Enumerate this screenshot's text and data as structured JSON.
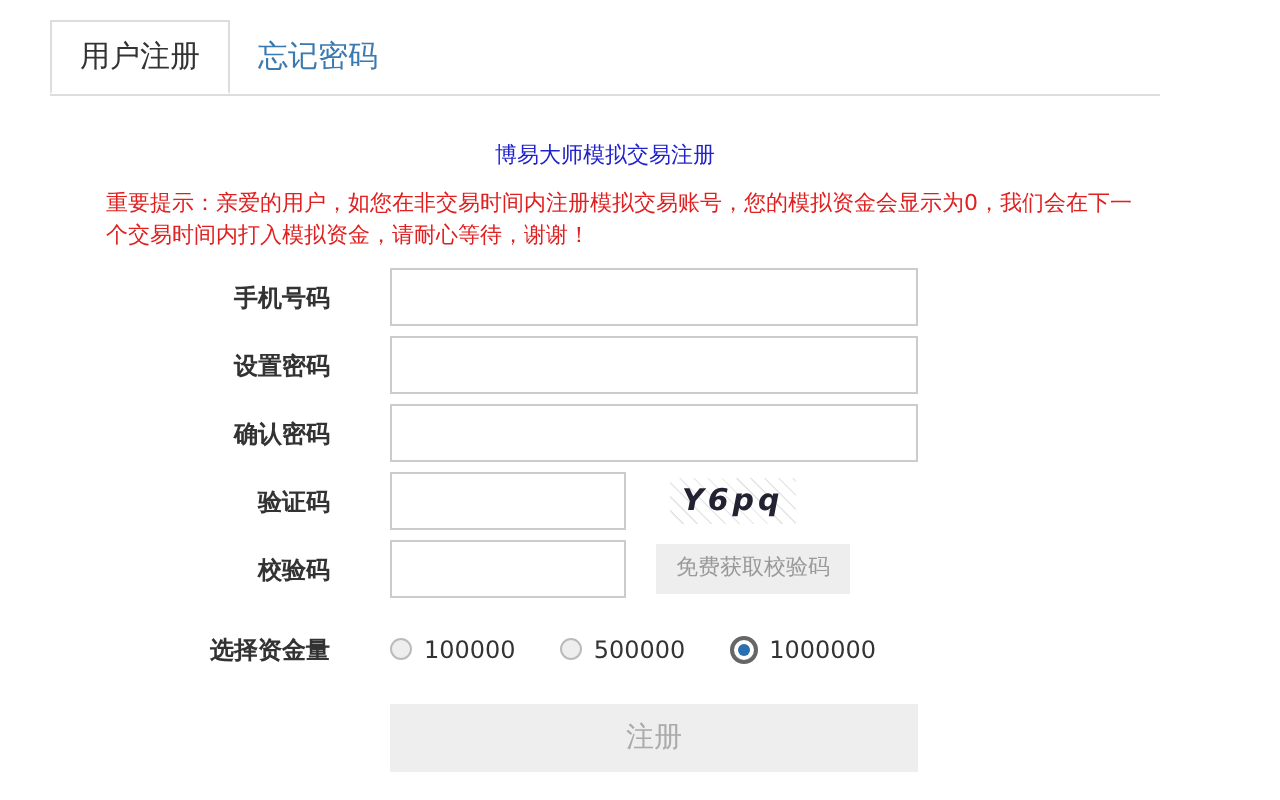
{
  "tabs": [
    {
      "label": "用户注册",
      "selected": true
    },
    {
      "label": "忘记密码",
      "selected": false
    }
  ],
  "title": "博易大师模拟交易注册",
  "notice": "重要提示：亲爱的用户，如您在非交易时间内注册模拟交易账号，您的模拟资金会显示为0，我们会在下一个交易时间内打入模拟资金，请耐心等待，谢谢！",
  "fields": [
    {
      "kind": "input",
      "label": "手机号码"
    },
    {
      "kind": "input",
      "label": "设置密码"
    },
    {
      "kind": "input",
      "label": "确认密码"
    },
    {
      "kind": "captcha",
      "label": "验证码",
      "captcha_text": "Y6pq"
    },
    {
      "kind": "sms",
      "label": "校验码",
      "button": "免费获取校验码"
    }
  ],
  "funds": {
    "label": "选择资金量",
    "options": [
      {
        "label": "100000",
        "selected": false
      },
      {
        "label": "500000",
        "selected": false
      },
      {
        "label": "1000000",
        "selected": true
      }
    ]
  },
  "submit": "注册"
}
